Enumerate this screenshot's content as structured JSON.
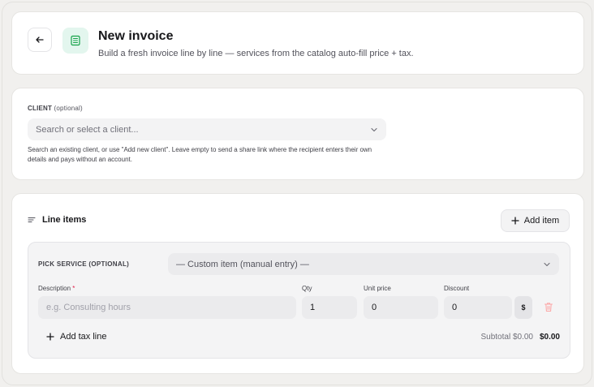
{
  "header": {
    "title": "New invoice",
    "subtitle": "Build a fresh invoice line by line — services from the catalog auto-fill price + tax."
  },
  "client": {
    "label": "CLIENT",
    "optional": "(optional)",
    "placeholder": "Search or select a client...",
    "help": "Search an existing client, or use \"Add new client\". Leave empty to send a share link where the recipient enters their own details and pays without an account."
  },
  "line_items": {
    "heading": "Line items",
    "add_item": "Add item",
    "pick_service_label": "PICK SERVICE (OPTIONAL)",
    "service_value": "— Custom item (manual entry) —",
    "columns": {
      "description": "Description",
      "qty": "Qty",
      "unit_price": "Unit price",
      "discount": "Discount"
    },
    "required_mark": "*",
    "description_placeholder": "e.g. Consulting hours",
    "qty": "1",
    "unit_price": "0",
    "discount": "0",
    "discount_unit": "$",
    "add_tax_line": "Add tax line",
    "subtotal_label": "Subtotal $0.00",
    "total": "$0.00"
  },
  "colors": {
    "accent_green": "#16a34a",
    "badge_bg": "#e3f6ee",
    "required": "#e11d48",
    "trash": "#fca5a5"
  }
}
